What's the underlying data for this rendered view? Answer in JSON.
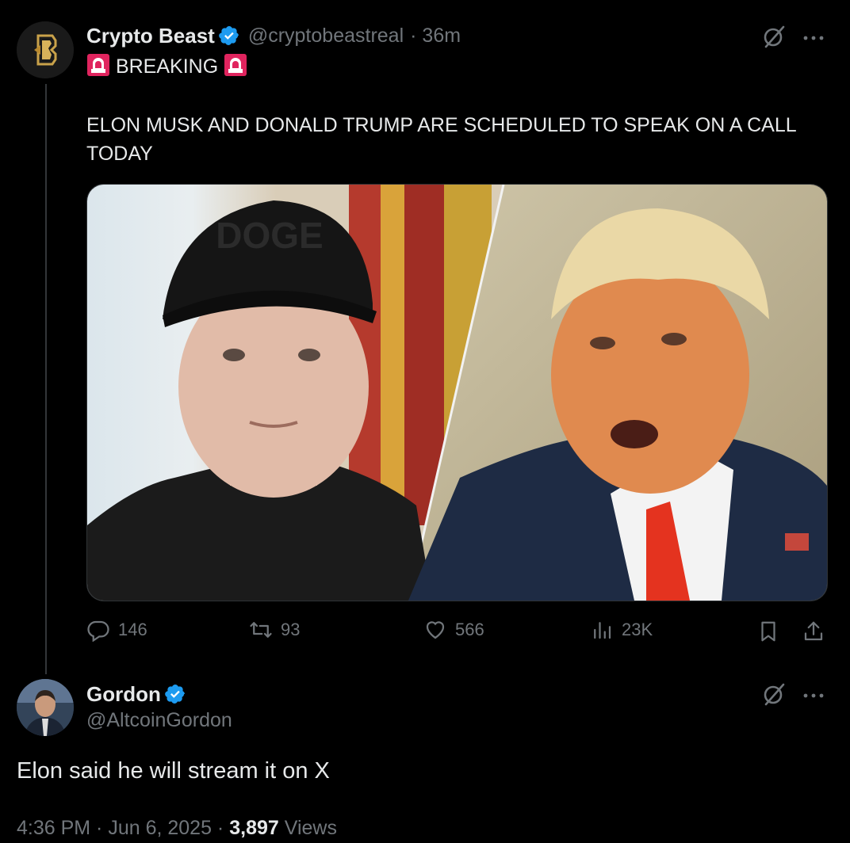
{
  "post": {
    "author": {
      "display_name": "Crypto Beast",
      "handle": "@cryptobeastreal",
      "time": "· 36m",
      "avatar_icon": "crypto-beast-logo"
    },
    "text_line1": "BREAKING",
    "text_line2": "ELON MUSK AND DONALD TRUMP ARE SCHEDULED TO SPEAK ON A CALL TODAY",
    "media_icon": "photo-collage-musk-trump",
    "media_caption_cap": "DOGE",
    "stats": {
      "replies": "146",
      "reposts": "93",
      "likes": "566",
      "views": "23K"
    }
  },
  "reply": {
    "author": {
      "display_name": "Gordon",
      "handle": "@AltcoinGordon",
      "avatar_icon": "profile-photo"
    },
    "text": "Elon said he will stream it on X",
    "meta_time": "4:36 PM · Jun 6, 2025 ·",
    "meta_views_count": "3,897",
    "meta_views_label": "Views"
  },
  "colors": {
    "background": "#000000",
    "text": "#e7e9ea",
    "muted": "#71767b",
    "verified_blue": "#1d9bf0",
    "siren_red": "#e0245e"
  }
}
